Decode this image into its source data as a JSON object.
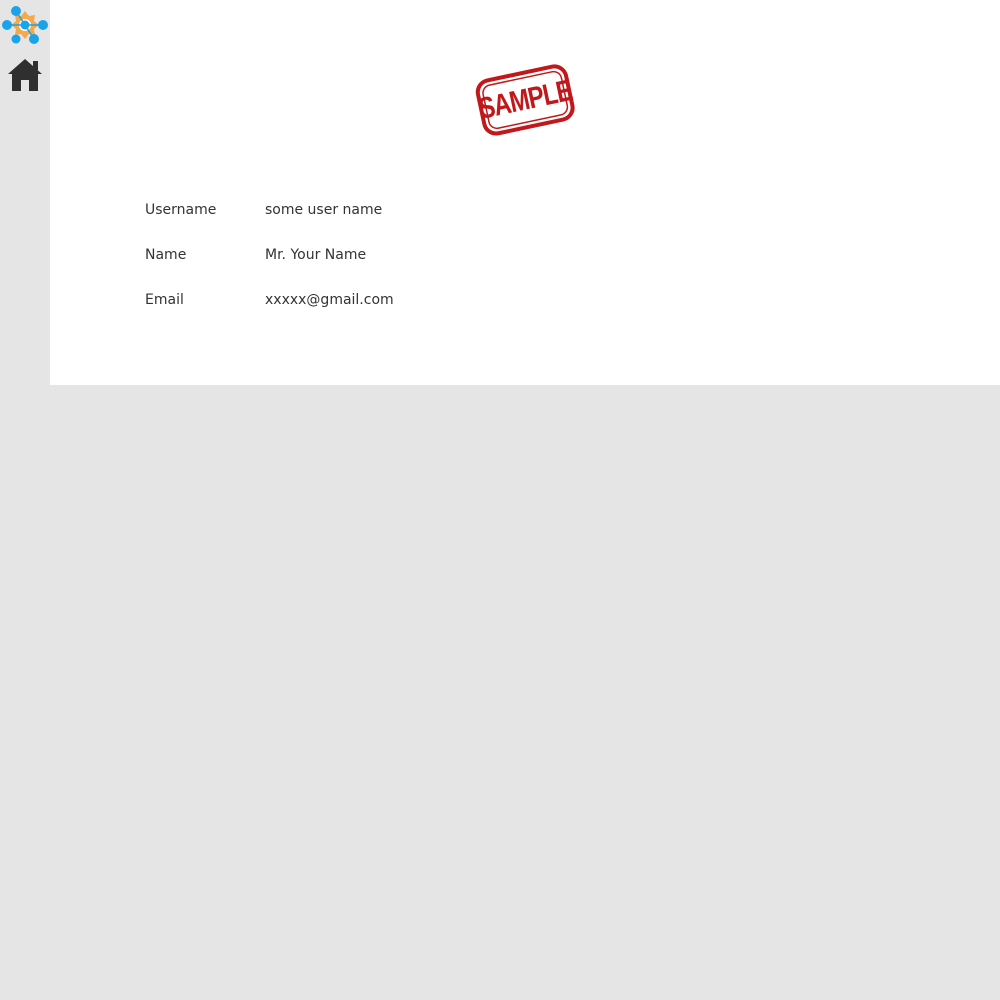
{
  "sidebar": {
    "logo_icon": "network-gear-logo-icon",
    "home_icon": "home-icon"
  },
  "stamp": {
    "icon": "sample-stamp-icon",
    "text": "SAMPLE",
    "color": "#c0181b"
  },
  "profile": {
    "rows": [
      {
        "label": "Username",
        "value": "some user name"
      },
      {
        "label": "Name",
        "value": "Mr. Your Name"
      },
      {
        "label": "Email",
        "value": "xxxxx@gmail.com"
      }
    ]
  },
  "colors": {
    "background": "#e5e5e5",
    "card": "#ffffff",
    "text": "#333333",
    "logo_gear": "#f5a94c",
    "logo_nodes": "#1aa3e8",
    "home_icon": "#2f2f2f"
  }
}
